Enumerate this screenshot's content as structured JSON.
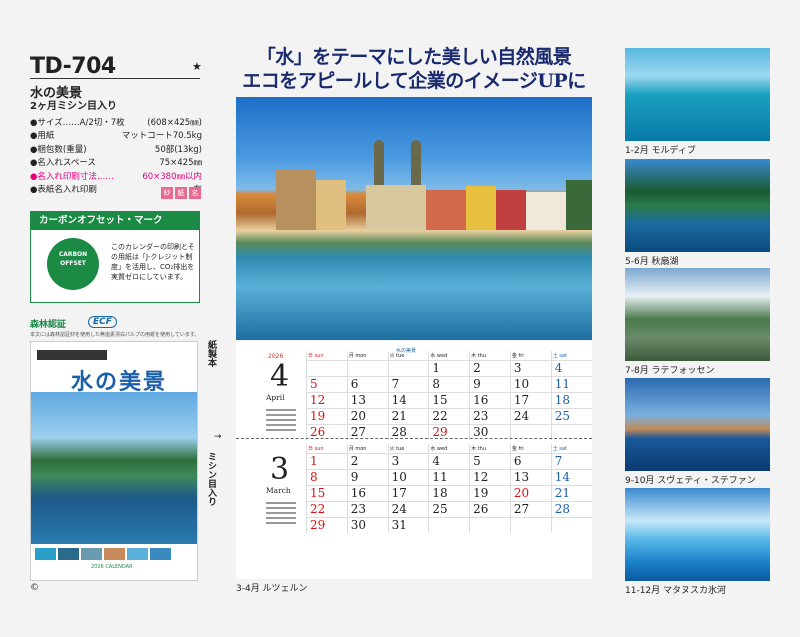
{
  "spec": {
    "model": "TD-704",
    "star": "★",
    "title": "水の美景",
    "subtitle": "2ヶ月ミシン目入り",
    "items": [
      {
        "k": "●サイズ……A/2切・7枚",
        "v": "(608×425㎜)",
        "pink": false
      },
      {
        "k": "●用紙",
        "v": "マットコート70.5kg",
        "pink": false
      },
      {
        "k": "●梱包数(重量)",
        "v": "50部(13kg)",
        "pink": false
      },
      {
        "k": "●名入れスペース",
        "v": "75×425㎜",
        "pink": false
      },
      {
        "k": "●名入れ印刷寸法……",
        "v": "60×380㎜以内",
        "pink": true
      },
      {
        "k": "●表紙名入れ印刷",
        "v": "有",
        "pink": false
      }
    ],
    "badges": [
      "紗",
      "紙",
      "名"
    ],
    "carbon_title": "カーボンオフセット・マーク",
    "carbon_logo": "CARBON OFFSET",
    "carbon_text": "このカレンダーの印刷とその用紙は「J-クレジット制度」を活用し、CO₂排出を実質ゼロにしています。",
    "forest": "森林認証",
    "ecf": "ECF",
    "forest_note": "本文には森林認証材を使用した無塩素漂白パルプの用紙を使用しています。",
    "copyright": "©"
  },
  "cover": {
    "title": "水の美景",
    "calendar_label": "2026 CALENDAR"
  },
  "side": {
    "kami": "紙製本",
    "mishin": "ミシン目入り",
    "arrow": "→"
  },
  "headline": {
    "line1": "「水」をテーマにした美しい自然風景",
    "line2": "エコをアピールして企業のイメージUPに"
  },
  "calendar": {
    "brand": "水の美景",
    "weekdays": [
      "日 sun",
      "月 mon",
      "火 tue",
      "水 wed",
      "木 thu",
      "金 fri",
      "土 sat"
    ],
    "months": [
      {
        "year": "2026",
        "num": "4",
        "name": "April",
        "rows": [
          [
            "",
            "",
            "",
            "1",
            "2",
            "3",
            "4"
          ],
          [
            "5",
            "6",
            "7",
            "8",
            "9",
            "10",
            "11"
          ],
          [
            "12",
            "13",
            "14",
            "15",
            "16",
            "17",
            "18"
          ],
          [
            "19",
            "20",
            "21",
            "22",
            "23",
            "24",
            "25"
          ],
          [
            "26",
            "27",
            "28",
            "29",
            "30",
            "",
            ""
          ]
        ],
        "holidays": [
          "29"
        ]
      },
      {
        "year": "",
        "num": "3",
        "name": "March",
        "rows": [
          [
            "1",
            "2",
            "3",
            "4",
            "5",
            "6",
            "7"
          ],
          [
            "8",
            "9",
            "10",
            "11",
            "12",
            "13",
            "14"
          ],
          [
            "15",
            "16",
            "17",
            "18",
            "19",
            "20",
            "21"
          ],
          [
            "22",
            "23",
            "24",
            "25",
            "26",
            "27",
            "28"
          ],
          [
            "29",
            "30",
            "31",
            "",
            "",
            "",
            ""
          ]
        ],
        "holidays": [
          "20"
        ]
      }
    ],
    "main_caption": "3-4月 ルツェルン"
  },
  "thumbs": [
    {
      "caption": "1-2月 モルディブ"
    },
    {
      "caption": "5-6月 秋扇湖"
    },
    {
      "caption": "7-8月 ラテフォッセン"
    },
    {
      "caption": "9-10月 スヴェティ・ステファン"
    },
    {
      "caption": "11-12月 マタヌスカ氷河"
    }
  ]
}
